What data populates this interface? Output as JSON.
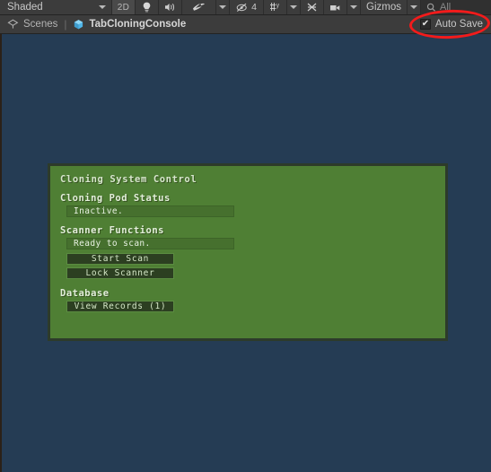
{
  "toolbar": {
    "draw_mode": "Shaded",
    "view_mode_2d": "2D",
    "lighting_icon": "lightbulb-icon",
    "audio_icon": "speaker-icon",
    "fx_icon": "effects-icon",
    "fx_dropdown_icon": "chevron-down-icon",
    "scene_visibility_icon": "eye-off-icon",
    "scene_visibility_count": "4",
    "grid_icon": "grid-snap-icon",
    "grid_dropdown_icon": "chevron-down-icon",
    "snap_icon": "snap-increment-icon",
    "camera_icon": "scene-camera-icon",
    "camera_dropdown_icon": "chevron-down-icon",
    "gizmos_label": "Gizmos",
    "gizmos_dropdown_icon": "chevron-down-icon",
    "search_icon": "search-icon",
    "search_placeholder": "All",
    "search_value": ""
  },
  "breadcrumb": {
    "scenes_icon": "scene-icon",
    "scenes_label": "Scenes",
    "separator": "|",
    "prefab_icon": "prefab-cube-icon",
    "prefab_name": "TabCloningConsole",
    "auto_save_label": "Auto Save",
    "auto_save_checked": true,
    "auto_save_tick": "✔"
  },
  "annotation": {
    "shape": "ellipse",
    "color": "#f31b1b",
    "target": "auto-save-checkbox"
  },
  "scene": {
    "background_color": "#253c54"
  },
  "game_panel": {
    "panel_color": "#4f7f34",
    "border_color": "#2d3b2a",
    "button_color": "#2c3f21",
    "button_border_color": "#5b8c41",
    "title": "Cloning System Control",
    "sections": [
      {
        "heading": "Cloning Pod Status",
        "status": "Inactive.",
        "buttons": []
      },
      {
        "heading": "Scanner Functions",
        "status": "Ready to scan.",
        "buttons": [
          "Start Scan",
          "Lock Scanner"
        ]
      },
      {
        "heading": "Database",
        "status": null,
        "buttons": [
          "View Records (1)"
        ]
      }
    ]
  }
}
